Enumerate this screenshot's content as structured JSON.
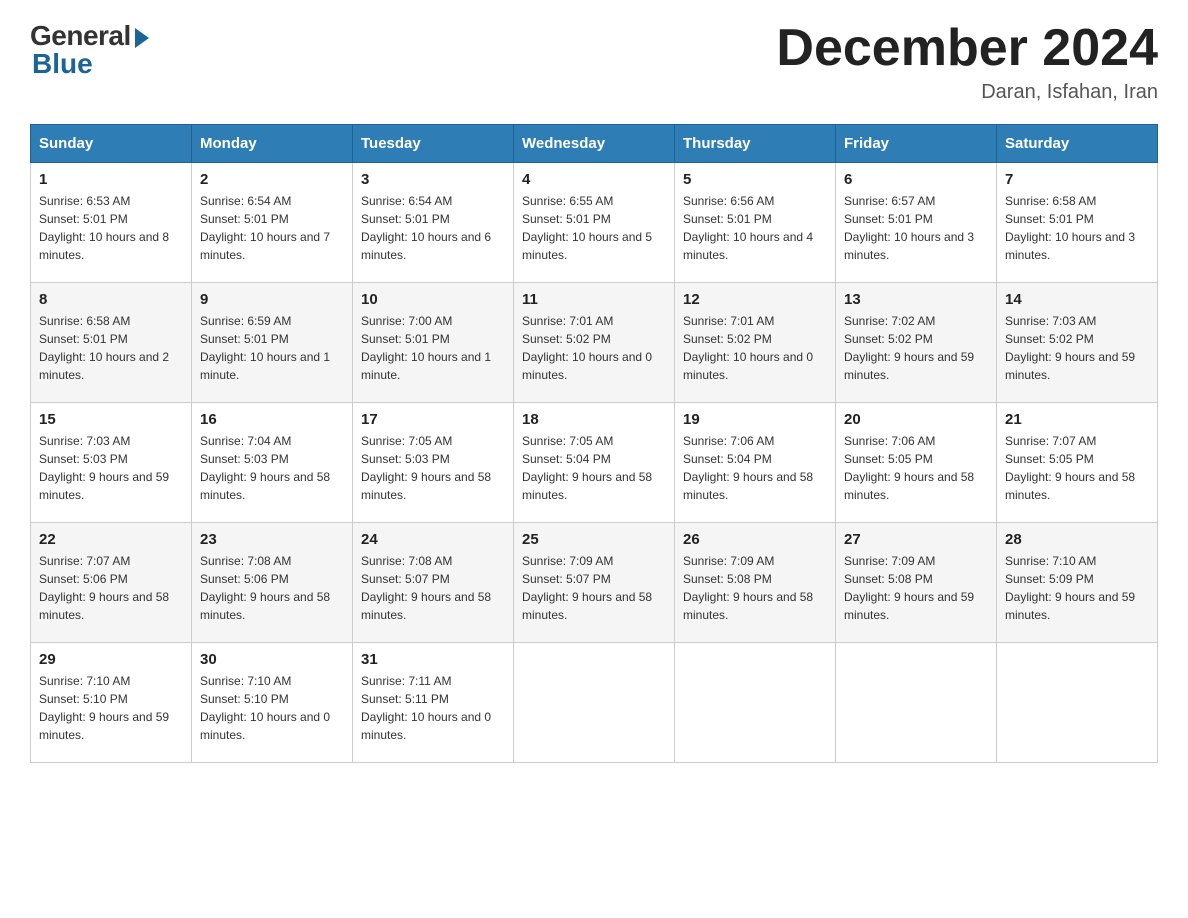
{
  "header": {
    "logo_general": "General",
    "logo_blue": "Blue",
    "title": "December 2024",
    "subtitle": "Daran, Isfahan, Iran"
  },
  "days_of_week": [
    "Sunday",
    "Monday",
    "Tuesday",
    "Wednesday",
    "Thursday",
    "Friday",
    "Saturday"
  ],
  "weeks": [
    [
      {
        "day": "1",
        "sunrise": "6:53 AM",
        "sunset": "5:01 PM",
        "daylight": "10 hours and 8 minutes."
      },
      {
        "day": "2",
        "sunrise": "6:54 AM",
        "sunset": "5:01 PM",
        "daylight": "10 hours and 7 minutes."
      },
      {
        "day": "3",
        "sunrise": "6:54 AM",
        "sunset": "5:01 PM",
        "daylight": "10 hours and 6 minutes."
      },
      {
        "day": "4",
        "sunrise": "6:55 AM",
        "sunset": "5:01 PM",
        "daylight": "10 hours and 5 minutes."
      },
      {
        "day": "5",
        "sunrise": "6:56 AM",
        "sunset": "5:01 PM",
        "daylight": "10 hours and 4 minutes."
      },
      {
        "day": "6",
        "sunrise": "6:57 AM",
        "sunset": "5:01 PM",
        "daylight": "10 hours and 3 minutes."
      },
      {
        "day": "7",
        "sunrise": "6:58 AM",
        "sunset": "5:01 PM",
        "daylight": "10 hours and 3 minutes."
      }
    ],
    [
      {
        "day": "8",
        "sunrise": "6:58 AM",
        "sunset": "5:01 PM",
        "daylight": "10 hours and 2 minutes."
      },
      {
        "day": "9",
        "sunrise": "6:59 AM",
        "sunset": "5:01 PM",
        "daylight": "10 hours and 1 minute."
      },
      {
        "day": "10",
        "sunrise": "7:00 AM",
        "sunset": "5:01 PM",
        "daylight": "10 hours and 1 minute."
      },
      {
        "day": "11",
        "sunrise": "7:01 AM",
        "sunset": "5:02 PM",
        "daylight": "10 hours and 0 minutes."
      },
      {
        "day": "12",
        "sunrise": "7:01 AM",
        "sunset": "5:02 PM",
        "daylight": "10 hours and 0 minutes."
      },
      {
        "day": "13",
        "sunrise": "7:02 AM",
        "sunset": "5:02 PM",
        "daylight": "9 hours and 59 minutes."
      },
      {
        "day": "14",
        "sunrise": "7:03 AM",
        "sunset": "5:02 PM",
        "daylight": "9 hours and 59 minutes."
      }
    ],
    [
      {
        "day": "15",
        "sunrise": "7:03 AM",
        "sunset": "5:03 PM",
        "daylight": "9 hours and 59 minutes."
      },
      {
        "day": "16",
        "sunrise": "7:04 AM",
        "sunset": "5:03 PM",
        "daylight": "9 hours and 58 minutes."
      },
      {
        "day": "17",
        "sunrise": "7:05 AM",
        "sunset": "5:03 PM",
        "daylight": "9 hours and 58 minutes."
      },
      {
        "day": "18",
        "sunrise": "7:05 AM",
        "sunset": "5:04 PM",
        "daylight": "9 hours and 58 minutes."
      },
      {
        "day": "19",
        "sunrise": "7:06 AM",
        "sunset": "5:04 PM",
        "daylight": "9 hours and 58 minutes."
      },
      {
        "day": "20",
        "sunrise": "7:06 AM",
        "sunset": "5:05 PM",
        "daylight": "9 hours and 58 minutes."
      },
      {
        "day": "21",
        "sunrise": "7:07 AM",
        "sunset": "5:05 PM",
        "daylight": "9 hours and 58 minutes."
      }
    ],
    [
      {
        "day": "22",
        "sunrise": "7:07 AM",
        "sunset": "5:06 PM",
        "daylight": "9 hours and 58 minutes."
      },
      {
        "day": "23",
        "sunrise": "7:08 AM",
        "sunset": "5:06 PM",
        "daylight": "9 hours and 58 minutes."
      },
      {
        "day": "24",
        "sunrise": "7:08 AM",
        "sunset": "5:07 PM",
        "daylight": "9 hours and 58 minutes."
      },
      {
        "day": "25",
        "sunrise": "7:09 AM",
        "sunset": "5:07 PM",
        "daylight": "9 hours and 58 minutes."
      },
      {
        "day": "26",
        "sunrise": "7:09 AM",
        "sunset": "5:08 PM",
        "daylight": "9 hours and 58 minutes."
      },
      {
        "day": "27",
        "sunrise": "7:09 AM",
        "sunset": "5:08 PM",
        "daylight": "9 hours and 59 minutes."
      },
      {
        "day": "28",
        "sunrise": "7:10 AM",
        "sunset": "5:09 PM",
        "daylight": "9 hours and 59 minutes."
      }
    ],
    [
      {
        "day": "29",
        "sunrise": "7:10 AM",
        "sunset": "5:10 PM",
        "daylight": "9 hours and 59 minutes."
      },
      {
        "day": "30",
        "sunrise": "7:10 AM",
        "sunset": "5:10 PM",
        "daylight": "10 hours and 0 minutes."
      },
      {
        "day": "31",
        "sunrise": "7:11 AM",
        "sunset": "5:11 PM",
        "daylight": "10 hours and 0 minutes."
      },
      null,
      null,
      null,
      null
    ]
  ],
  "labels": {
    "sunrise": "Sunrise:",
    "sunset": "Sunset:",
    "daylight": "Daylight:"
  }
}
